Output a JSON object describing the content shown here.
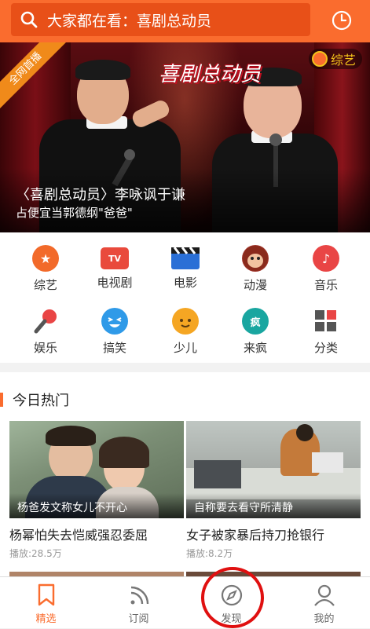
{
  "header": {
    "search_placeholder": "大家都在看：喜剧总动员",
    "search_icon": "search-icon",
    "history_icon": "clock-icon"
  },
  "banner": {
    "ribbon_text": "全网首播",
    "show_logo": "喜剧总动员",
    "tag": "综艺",
    "title": "〈喜剧总动员〉李咏讽于谦",
    "subtitle": "占便宜当郭德纲\"爸爸\"",
    "slides_total": 7,
    "active_slide": 1
  },
  "categories": [
    {
      "label": "综艺",
      "icon": "star-icon",
      "color": "#f26a2a"
    },
    {
      "label": "电视剧",
      "icon": "tv-icon",
      "color": "#e94a3c"
    },
    {
      "label": "电影",
      "icon": "clapperboard-icon",
      "color": "#2a6fd6"
    },
    {
      "label": "动漫",
      "icon": "monkey-icon",
      "color": "#c0392b"
    },
    {
      "label": "音乐",
      "icon": "music-note-icon",
      "color": "#e94545"
    },
    {
      "label": "娱乐",
      "icon": "microphone-icon",
      "color": "#e94545"
    },
    {
      "label": "搞笑",
      "icon": "laugh-face-icon",
      "color": "#2f9ae8"
    },
    {
      "label": "少儿",
      "icon": "child-face-icon",
      "color": "#f5a623"
    },
    {
      "label": "来疯",
      "icon": "laifeng-icon",
      "color": "#19a6a0"
    },
    {
      "label": "分类",
      "icon": "grid-icon",
      "color": "#555555"
    }
  ],
  "section": {
    "title": "今日热门",
    "cards": [
      {
        "caption": "杨爸发文称女儿不开心",
        "title": "杨幂怕失去恺威强忍委屈",
        "plays": "播放:28.5万"
      },
      {
        "caption": "自称要去看守所清静",
        "title": "女子被家暴后持刀抢银行",
        "plays": "播放:8.2万"
      }
    ]
  },
  "bottom_nav": [
    {
      "label": "精选",
      "icon": "bookmark-icon",
      "active": true
    },
    {
      "label": "订阅",
      "icon": "rss-icon",
      "active": false
    },
    {
      "label": "发现",
      "icon": "compass-icon",
      "active": false
    },
    {
      "label": "我的",
      "icon": "user-icon",
      "active": false
    }
  ],
  "colors": {
    "accent": "#fa6c2e",
    "annotation": "#e01010"
  }
}
